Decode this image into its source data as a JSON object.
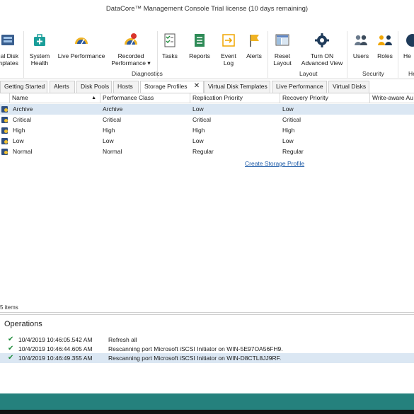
{
  "window": {
    "title": "DataCore™ Management Console    Trial license (10 days remaining)"
  },
  "ribbon": {
    "buttons": [
      {
        "label": "ual Disk\nmplates",
        "icon": "virtual-disk-templates-icon"
      },
      {
        "label": "System\nHealth",
        "icon": "system-health-icon"
      },
      {
        "label": "Live Performance",
        "icon": "live-performance-icon"
      },
      {
        "label": "Recorded\nPerformance ▾",
        "icon": "recorded-performance-icon"
      },
      {
        "label": "Tasks",
        "icon": "tasks-icon"
      },
      {
        "label": "Reports",
        "icon": "reports-icon"
      },
      {
        "label": "Event\nLog",
        "icon": "event-log-icon"
      },
      {
        "label": "Alerts",
        "icon": "alerts-flag-icon"
      },
      {
        "label": "Reset\nLayout",
        "icon": "reset-layout-icon"
      },
      {
        "label": "Turn ON\nAdvanced View",
        "icon": "advanced-view-gear-icon"
      },
      {
        "label": "Users",
        "icon": "users-icon"
      },
      {
        "label": "Roles",
        "icon": "roles-icon"
      },
      {
        "label": "He",
        "icon": "help-icon"
      }
    ],
    "groups": [
      "Diagnostics",
      "Layout",
      "Security",
      "He"
    ]
  },
  "tabs": [
    {
      "label": "Getting Started"
    },
    {
      "label": "Alerts"
    },
    {
      "label": "Disk Pools"
    },
    {
      "label": "Hosts"
    },
    {
      "label": "Storage Profiles",
      "active": true
    },
    {
      "label": "Virtual Disk Templates"
    },
    {
      "label": "Live Performance"
    },
    {
      "label": "Virtual Disks"
    }
  ],
  "grid": {
    "columns": [
      "Name",
      "Performance Class",
      "Replication Priority",
      "Recovery Priority",
      "Write-aware Au"
    ],
    "sort_indicator": "▲",
    "rows": [
      {
        "name": "Archive",
        "performance": "Archive",
        "replication": "Low",
        "recovery": "Low"
      },
      {
        "name": "Critical",
        "performance": "Critical",
        "replication": "Critical",
        "recovery": "Critical"
      },
      {
        "name": "High",
        "performance": "High",
        "replication": "High",
        "recovery": "High"
      },
      {
        "name": "Low",
        "performance": "Low",
        "replication": "Low",
        "recovery": "Low"
      },
      {
        "name": "Normal",
        "performance": "Normal",
        "replication": "Regular",
        "recovery": "Regular"
      }
    ],
    "create_link": "Create Storage Profile",
    "item_count": "5 items"
  },
  "operations": {
    "title": "Operations",
    "items": [
      {
        "time": "10/4/2019 10:46:05.542 AM",
        "message": "Refresh all"
      },
      {
        "time": "10/4/2019 10:46:44.605 AM",
        "message": "Rescanning port Microsoft iSCSI Initiator on WIN-5E97OA56FH9."
      },
      {
        "time": "10/4/2019 10:46:49.355 AM",
        "message": "Rescanning port Microsoft iSCSI Initiator on WIN-D8CTL8JJ9RF."
      }
    ]
  },
  "colors": {
    "accent": "#25817d",
    "selection": "#dbe7f3",
    "link": "#1f5ca8",
    "check": "#1e8c3a"
  }
}
